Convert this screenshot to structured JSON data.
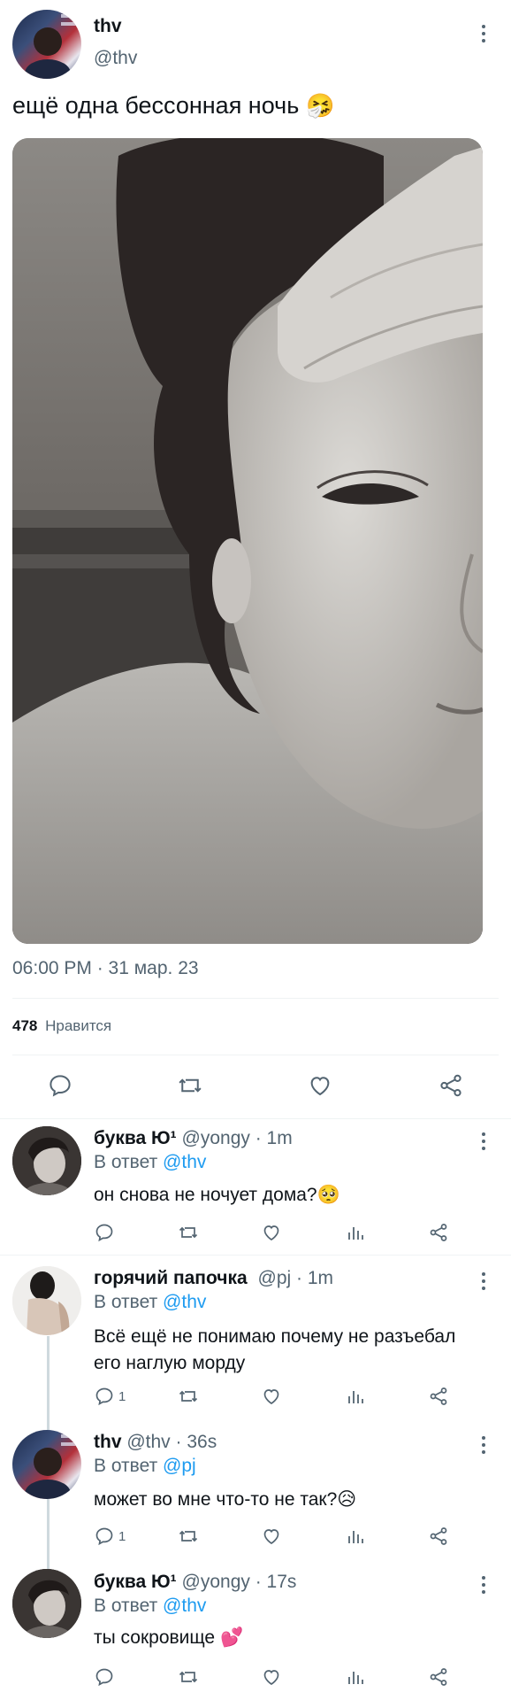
{
  "main_tweet": {
    "display_name": "thv",
    "handle": "@thv",
    "text": "ещё одна бессонная ночь",
    "emoji": "🤧",
    "timestamp": "06:00 PM · 31 мар. 23",
    "likes_count": "478",
    "likes_label": "Нравится",
    "actions": [
      "reply-icon",
      "retweet-icon",
      "like-icon",
      "share-icon"
    ]
  },
  "replies": [
    {
      "display_name": "буква Ю¹",
      "handle": "@yongy",
      "time": "· 1m",
      "reply_prefix": "В ответ",
      "reply_to": "@thv",
      "text": "он снова не ночует дома?",
      "emoji": "🥺",
      "reply_count": ""
    },
    {
      "display_name": "горячий папочка",
      "handle": "@pj",
      "time": "· 1m",
      "reply_prefix": "В ответ",
      "reply_to": "@thv",
      "text_line1": "Всё ещё не понимаю почему не разъебал",
      "text_line2": "его наглую морду",
      "reply_count": "1"
    },
    {
      "display_name": "thv",
      "handle": "@thv",
      "time": "· 36s",
      "reply_prefix": "В ответ",
      "reply_to": "@pj",
      "text": "может во мне что-то не так?",
      "emoji": "😥",
      "reply_count": "1"
    },
    {
      "display_name": "буква Ю¹",
      "handle": "@yongy",
      "time": "· 17s",
      "reply_prefix": "В ответ",
      "reply_to": "@thv",
      "text": "ты сокровище",
      "emoji": "💕",
      "reply_count": ""
    }
  ],
  "colors": {
    "accent": "#1d9bf0",
    "muted": "#536471",
    "divider": "#eff3f4",
    "text": "#0f1419"
  }
}
